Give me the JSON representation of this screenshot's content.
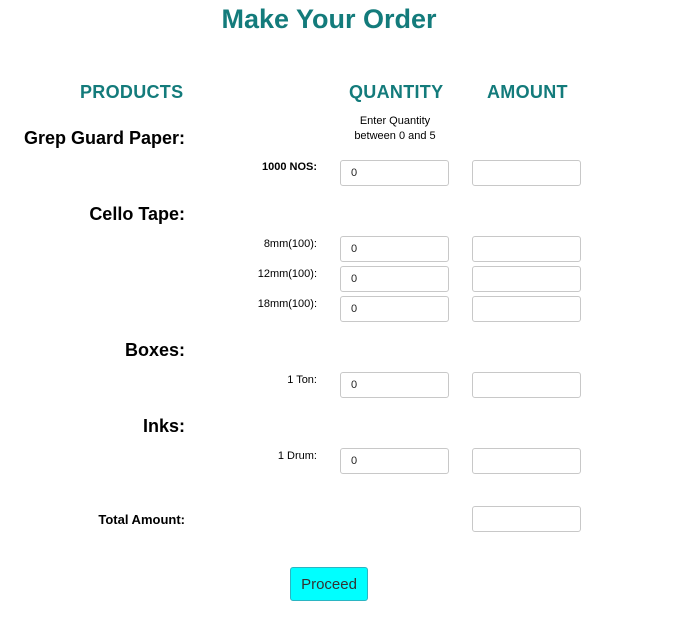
{
  "page": {
    "title": "Make Your Order"
  },
  "headers": {
    "products": "PRODUCTS",
    "quantity": "QUANTITY",
    "amount": "AMOUNT"
  },
  "quantity_hint": {
    "line1": "Enter Quantity",
    "line2": "between 0 and 5"
  },
  "products": [
    {
      "name": "Grep Guard Paper:",
      "items": [
        {
          "label": "1000 NOS:",
          "quantity": "0",
          "amount": ""
        }
      ]
    },
    {
      "name": "Cello Tape:",
      "items": [
        {
          "label": "8mm(100):",
          "quantity": "0",
          "amount": ""
        },
        {
          "label": "12mm(100):",
          "quantity": "0",
          "amount": ""
        },
        {
          "label": "18mm(100):",
          "quantity": "0",
          "amount": ""
        }
      ]
    },
    {
      "name": "Boxes:",
      "items": [
        {
          "label": "1 Ton:",
          "quantity": "0",
          "amount": ""
        }
      ]
    },
    {
      "name": "Inks:",
      "items": [
        {
          "label": "1 Drum:",
          "quantity": "0",
          "amount": ""
        }
      ]
    }
  ],
  "total": {
    "label": "Total Amount:",
    "value": ""
  },
  "actions": {
    "proceed_label": "Proceed"
  },
  "colors": {
    "heading": "#137b7b",
    "proceed_button": "#00ffff"
  }
}
